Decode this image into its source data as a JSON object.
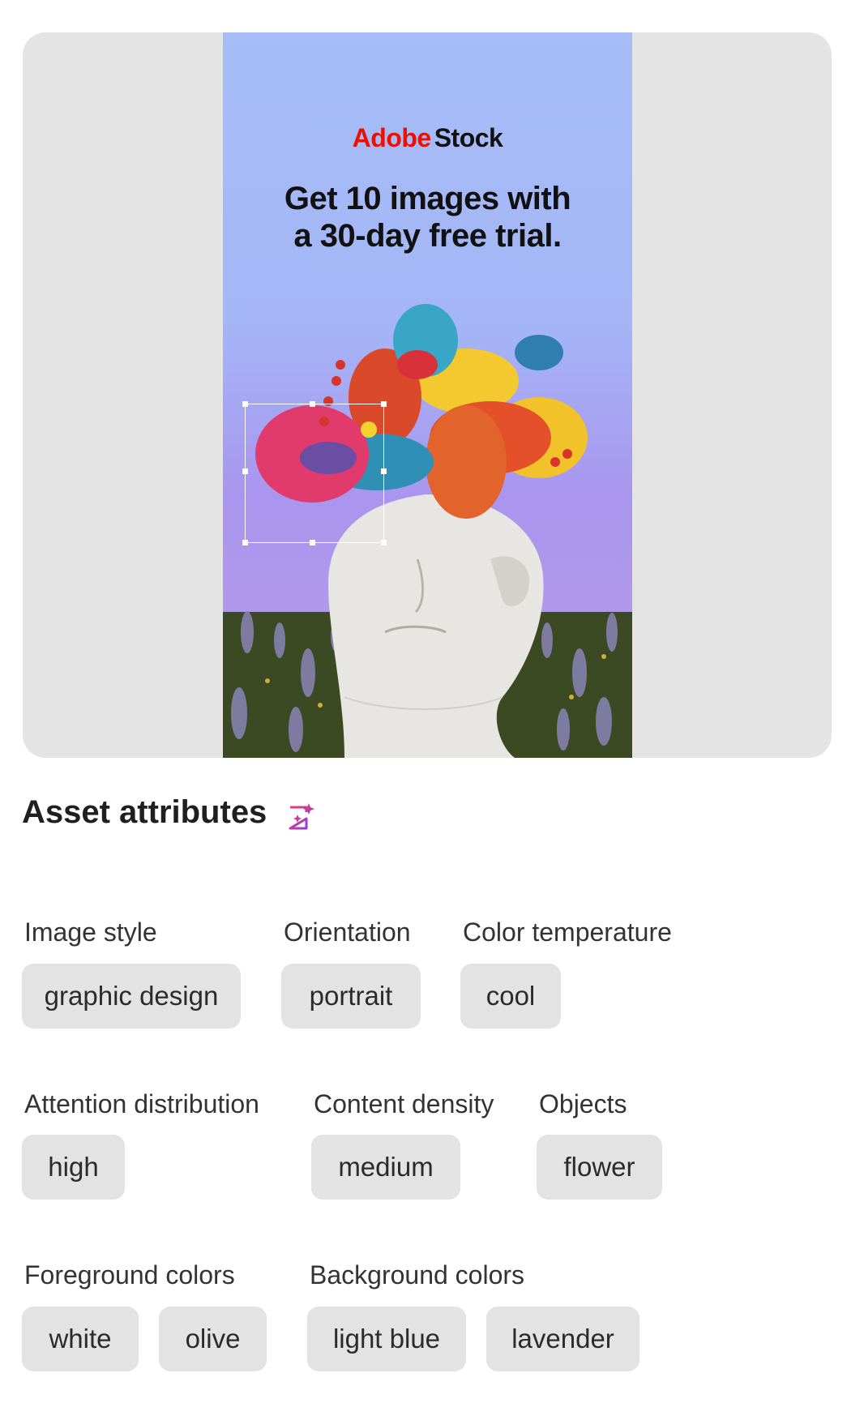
{
  "preview": {
    "ad": {
      "brand": "Adobe",
      "product": "Stock",
      "headline_line1": "Get 10 images with",
      "headline_line2": "a 30-day free trial."
    }
  },
  "attributes": {
    "title": "Asset attributes",
    "icon": "sparkle-icon",
    "groups": {
      "image_style": {
        "label": "Image style",
        "values": [
          "graphic design"
        ]
      },
      "orientation": {
        "label": "Orientation",
        "values": [
          "portrait"
        ]
      },
      "color_temperature": {
        "label": "Color temperature",
        "values": [
          "cool"
        ]
      },
      "attention_distribution": {
        "label": "Attention distribution",
        "values": [
          "high"
        ]
      },
      "content_density": {
        "label": "Content density",
        "values": [
          "medium"
        ]
      },
      "objects": {
        "label": "Objects",
        "values": [
          "flower"
        ]
      },
      "foreground_colors": {
        "label": "Foreground colors",
        "values": [
          "white",
          "olive"
        ]
      },
      "background_colors": {
        "label": "Background colors",
        "values": [
          "light blue",
          "lavender"
        ]
      }
    }
  },
  "colors": {
    "brand_red": "#eb1000",
    "chip_bg": "#e3e3e3",
    "card_bg": "#e4e4e4",
    "accent_sparkle": "#d12f8c"
  }
}
